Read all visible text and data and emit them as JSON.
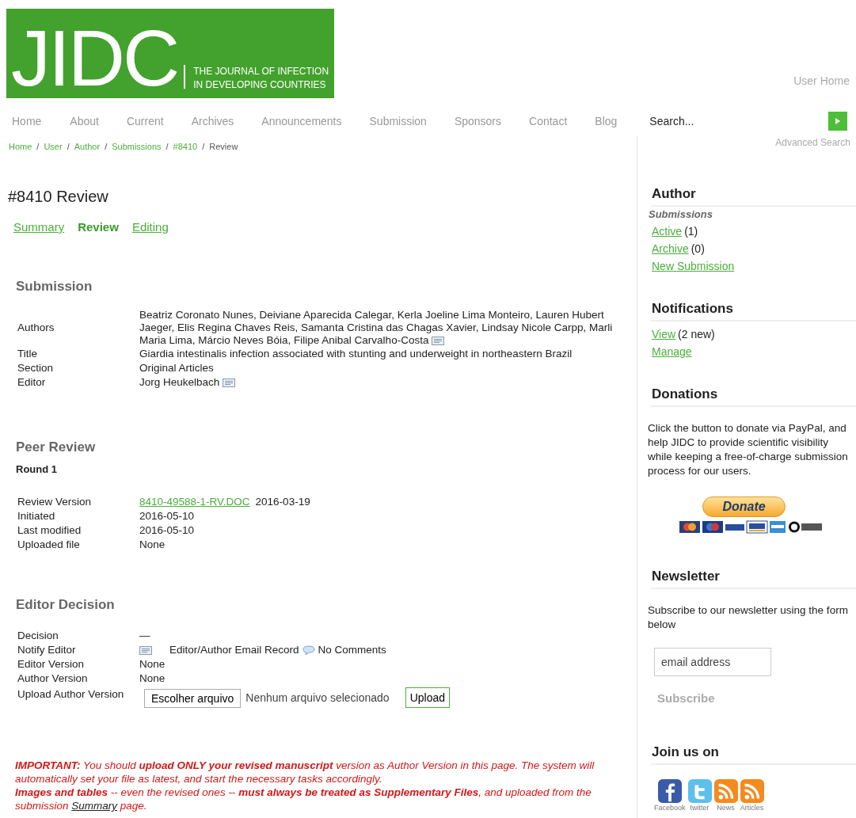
{
  "logo": {
    "wordmark": "JIDC",
    "tagline": [
      "THE JOURNAL OF INFECTION",
      "IN DEVELOPING COUNTRIES"
    ]
  },
  "user_home": "User Home",
  "nav": [
    "Home",
    "About",
    "Current",
    "Archives",
    "Announcements",
    "Submission",
    "Sponsors",
    "Contact",
    "Blog"
  ],
  "search": {
    "placeholder": "Search...",
    "advanced": "Advanced Search"
  },
  "breadcrumb": [
    {
      "label": "Home",
      "kind": "link"
    },
    {
      "separator": "/",
      "label": "User",
      "kind": "link"
    },
    {
      "separator": "/",
      "label": "Author",
      "kind": "link"
    },
    {
      "separator": "/",
      "label": "Submissions",
      "kind": "link"
    },
    {
      "separator": "/",
      "label": "#8410",
      "kind": "link"
    },
    {
      "separator": "/",
      "label": "Review",
      "kind": "current"
    }
  ],
  "page_title": "#8410 Review",
  "tabs": [
    {
      "label": "Summary",
      "selected": false
    },
    {
      "label": "Review",
      "selected": true
    },
    {
      "label": "Editing",
      "selected": false
    }
  ],
  "submission": {
    "heading": "Submission",
    "rows": [
      {
        "label": "Authors",
        "kind": "text",
        "value": "Beatriz Coronato Nunes, Deiviane Aparecida Calegar, Kerla Joeline Lima Monteiro, Lauren Hubert Jaeger, Elis Regina Chaves Reis, Samanta Cristina das Chagas Xavier, Lindsay Nicole Carpp, Marli Maria Lima, Márcio Neves Bóia, Filipe Anibal Carvalho-Costa",
        "email_icon": true
      },
      {
        "label": "Title",
        "kind": "text",
        "value": "Giardia intestinalis infection associated with stunting and underweight in northeastern Brazil"
      },
      {
        "label": "Section",
        "kind": "text",
        "value": "Original Articles"
      },
      {
        "label": "Editor",
        "kind": "text",
        "value": "Jorg Heukelbach",
        "email_icon": true
      }
    ]
  },
  "peer_review": {
    "heading": "Peer Review",
    "round": "Round 1",
    "rows": [
      {
        "label": "Review Version",
        "kind": "file",
        "link": "8410-49588-1-RV.DOC",
        "date": "2016-03-19"
      },
      {
        "label": "Initiated",
        "kind": "text",
        "value": "2016-05-10"
      },
      {
        "label": "Last modified",
        "kind": "text",
        "value": "2016-05-10"
      },
      {
        "label": "Uploaded file",
        "kind": "text",
        "value": "None"
      }
    ]
  },
  "editor_decision": {
    "heading": "Editor Decision",
    "rows": [
      {
        "label": "Decision",
        "kind": "text",
        "value": "—"
      },
      {
        "label": "Notify Editor",
        "kind": "notify",
        "record": "Editor/Author Email Record",
        "comments": "No Comments"
      },
      {
        "label": "Editor Version",
        "kind": "text",
        "value": "None"
      },
      {
        "label": "Author Version",
        "kind": "text",
        "value": "None"
      },
      {
        "label": "Upload Author Version",
        "kind": "upload",
        "choose": "Escolher arquivo",
        "no_file": "Nenhum arquivo selecionado",
        "upload": "Upload"
      }
    ]
  },
  "notice": [
    {
      "text": "**IMPORTANT:** You should **upload ONLY your revised manuscript** version as Author Version in this page. The system will automatically set your file as latest, and start the necessary tasks accordingly."
    },
    {
      "text": "**Images and tables** -- even the revised ones -- **must always be treated as Supplementary Files**, and uploaded from the submission ",
      "link": "Summary",
      "after": " page."
    }
  ],
  "sidebar": {
    "author": {
      "heading": "Author",
      "subheading": "Submissions",
      "items": [
        {
          "link": "Active",
          "count": "(1)"
        },
        {
          "link": "Archive",
          "count": "(0)"
        },
        {
          "link": "New Submission"
        }
      ]
    },
    "notifications": {
      "heading": "Notifications",
      "items": [
        {
          "link": "View",
          "count": "(2 new)"
        },
        {
          "link": "Manage"
        }
      ]
    },
    "donations": {
      "heading": "Donations",
      "text": "Click the button to donate via PayPal, and help JIDC to provide scientific visibility while keeping a free-of-charge submission process for our users.",
      "button": "Donate"
    },
    "newsletter": {
      "heading": "Newsletter",
      "text": "Subscribe to our newsletter using the form below",
      "placeholder": "email address",
      "button": "Subscribe"
    },
    "social": {
      "heading": "Join us on",
      "items": [
        {
          "label": "Facebook",
          "kind": "facebook"
        },
        {
          "label": "twitter",
          "kind": "twitter"
        },
        {
          "label": "News",
          "kind": "rss"
        },
        {
          "label": "Articles",
          "kind": "rss"
        }
      ]
    }
  }
}
